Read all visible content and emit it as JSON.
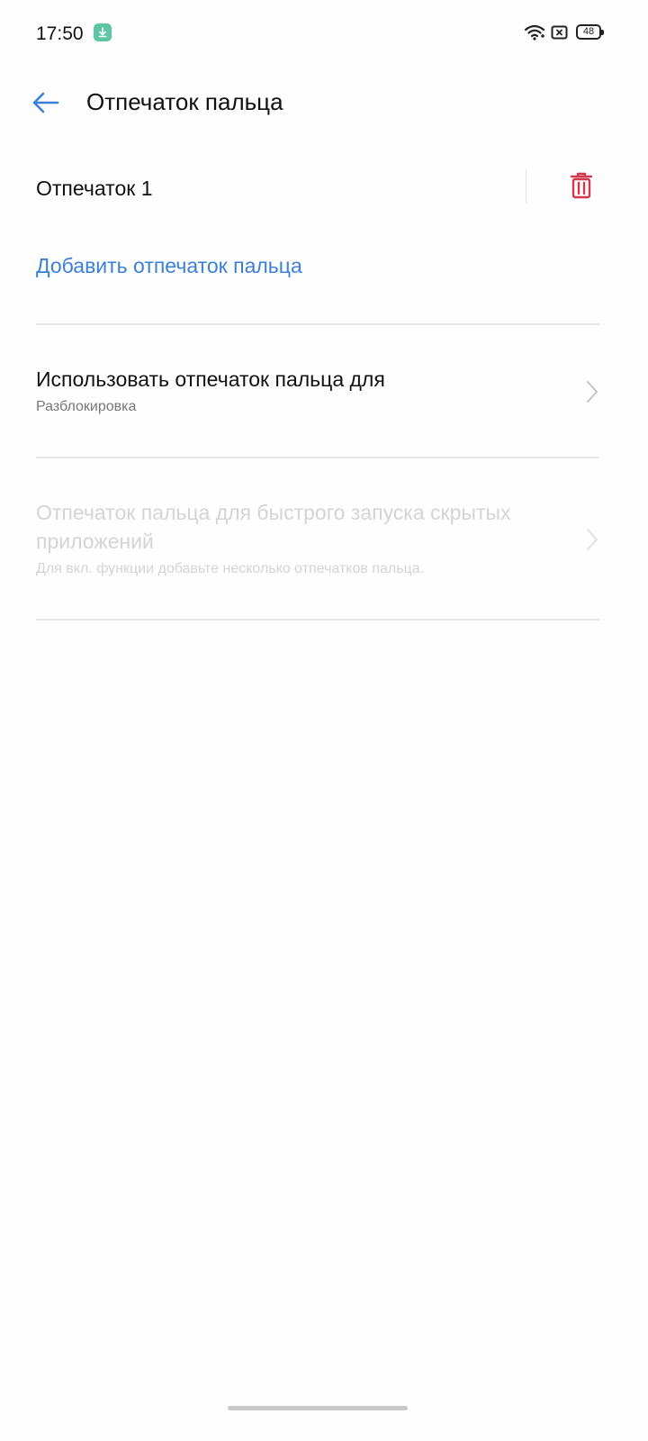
{
  "status_bar": {
    "time": "17:50",
    "battery": "48",
    "icons": [
      "download-notification-icon",
      "wifi-icon",
      "sim-off-icon",
      "battery-icon"
    ]
  },
  "header": {
    "back_icon": "arrow-left-icon",
    "title": "Отпечаток пальца"
  },
  "fingerprints": [
    {
      "name": "Отпечаток 1",
      "action_icon": "trash-icon"
    }
  ],
  "add_fingerprint": "Добавить отпечаток пальца",
  "settings": [
    {
      "title": "Использовать отпечаток пальца для",
      "subtitle": "Разблокировка",
      "enabled": true
    },
    {
      "title": "Отпечаток пальца для быстрого запуска скрытых приложений",
      "subtitle": "Для вкл. функции добавьте несколько отпечатков пальца.",
      "enabled": false
    }
  ],
  "colors": {
    "accent": "#3a7fd8",
    "delete": "#d2374e",
    "notification": "#5fc6a5",
    "disabled_text": "#d4d4d4"
  }
}
